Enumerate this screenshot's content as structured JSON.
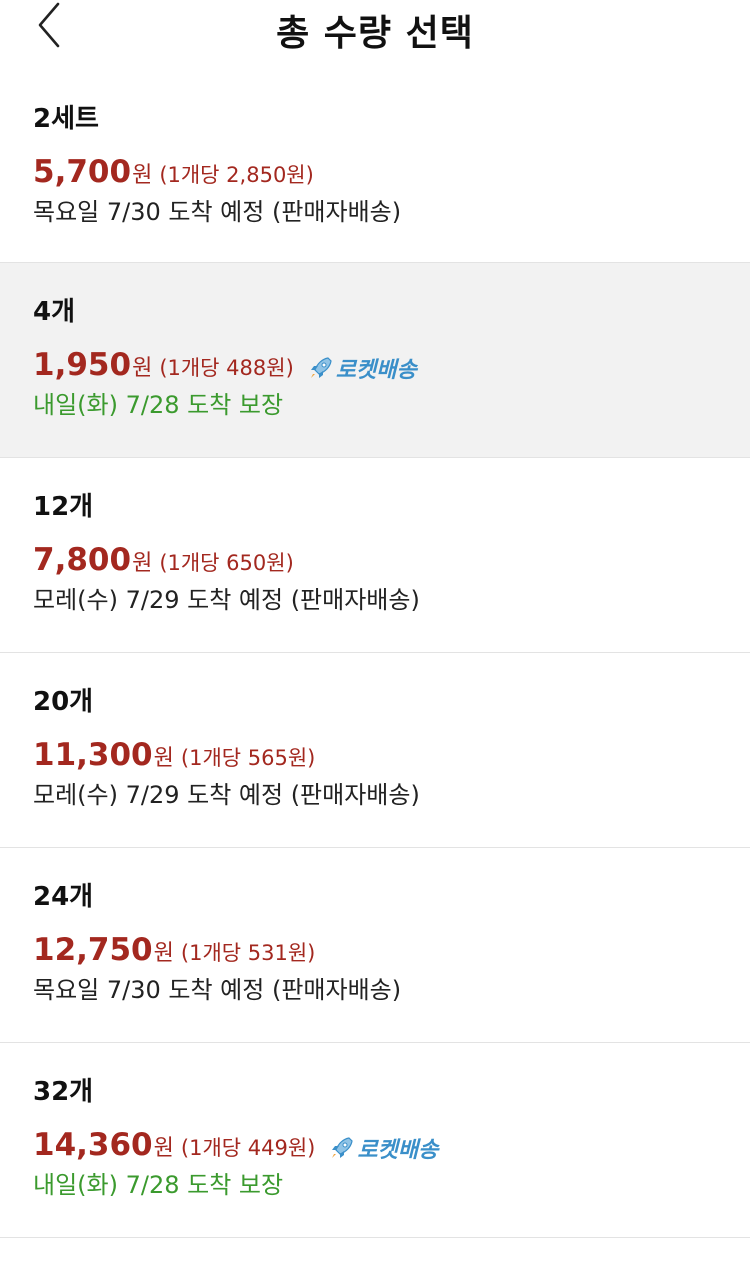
{
  "header": {
    "title": "총 수량 선택",
    "back_icon": "chevron-left-icon"
  },
  "colors": {
    "price": "#a3281f",
    "rocket": "#3a8fc9",
    "guarantee": "#3b9a2e",
    "selected_bg": "#f2f2f2"
  },
  "options": [
    {
      "quantity": "2세트",
      "price": "5,700",
      "won": "원",
      "unit_price": "(1개당 2,850원)",
      "rocket_label": "",
      "delivery": "목요일 7/30 도착 예정 (판매자배송)",
      "selected": false
    },
    {
      "quantity": "4개",
      "price": "1,950",
      "won": "원",
      "unit_price": "(1개당 488원)",
      "rocket_label": "로켓배송",
      "delivery": "내일(화) 7/28 도착 보장",
      "selected": true
    },
    {
      "quantity": "12개",
      "price": "7,800",
      "won": "원",
      "unit_price": "(1개당 650원)",
      "rocket_label": "",
      "delivery": "모레(수) 7/29 도착 예정 (판매자배송)",
      "selected": false
    },
    {
      "quantity": "20개",
      "price": "11,300",
      "won": "원",
      "unit_price": "(1개당 565원)",
      "rocket_label": "",
      "delivery": "모레(수) 7/29 도착 예정 (판매자배송)",
      "selected": false
    },
    {
      "quantity": "24개",
      "price": "12,750",
      "won": "원",
      "unit_price": "(1개당 531원)",
      "rocket_label": "",
      "delivery": "목요일 7/30 도착 예정 (판매자배송)",
      "selected": false
    },
    {
      "quantity": "32개",
      "price": "14,360",
      "won": "원",
      "unit_price": "(1개당 449원)",
      "rocket_label": "로켓배송",
      "delivery": "내일(화) 7/28 도착 보장",
      "selected": false
    }
  ]
}
